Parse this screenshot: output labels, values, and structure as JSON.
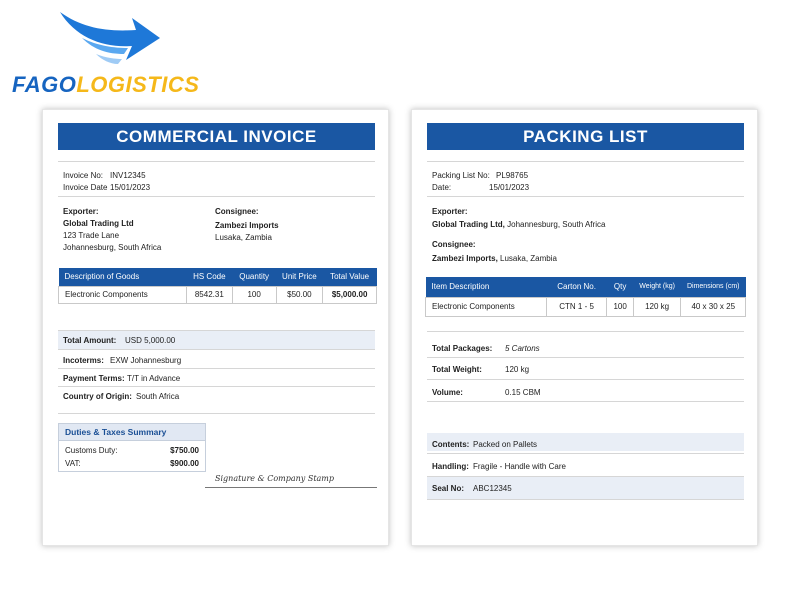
{
  "logo": {
    "part1": "FAGO",
    "part2": "LOGISTICS",
    "primary_color": "#1664c0",
    "accent_color": "#f5b81a"
  },
  "invoice": {
    "title": "COMMERCIAL INVOICE",
    "invoice_no_label": "Invoice No:",
    "invoice_no": "INV12345",
    "invoice_date_label": "Invoice Date",
    "invoice_date": "15/01/2023",
    "exporter_label": "Exporter:",
    "exporter_name": "Global Trading Ltd",
    "exporter_addr1": "123 Trade Lane",
    "exporter_addr2": "Johannesburg, South Africa",
    "consignee_label": "Consignee:",
    "consignee_name": "Zambezi Imports",
    "consignee_addr": "Lusaka, Zambia",
    "table_headers": [
      "Description of Goods",
      "HS Code",
      "Quantity",
      "Unit Price",
      "Total Value"
    ],
    "table_rows": [
      [
        "Electronic Components",
        "8542.31",
        "100",
        "$50.00",
        "$5,000.00"
      ]
    ],
    "total_amount_label": "Total Amount:",
    "total_amount": "USD 5,000.00",
    "incoterms_label": "Incoterms:",
    "incoterms": "EXW Johannesburg",
    "payment_terms_label": "Payment Terms:",
    "payment_terms": "T/T in Advance",
    "origin_label": "Country of Origin:",
    "origin": "South Africa",
    "duties_title": "Duties & Taxes Summary",
    "customs_label": "Customs Duty:",
    "customs_value": "$750.00",
    "vat_label": "VAT:",
    "vat_value": "$900.00",
    "signature": "Signature & Company Stamp"
  },
  "packing": {
    "title": "PACKING LIST",
    "list_no_label": "Packing List No:",
    "list_no": "PL98765",
    "date_label": "Date:",
    "date": "15/01/2023",
    "exporter_label": "Exporter:",
    "exporter_name": "Global Trading Ltd,",
    "exporter_addr": "Johannesburg, South Africa",
    "consignee_label": "Consignee:",
    "consignee_name": "Zambezi Imports,",
    "consignee_addr": "Lusaka, Zambia",
    "table_headers": [
      "Item Description",
      "Carton No.",
      "Qty",
      "Weight (kg)",
      "Dimensions (cm)"
    ],
    "table_rows": [
      [
        "Electronic Components",
        "CTN 1 - 5",
        "100",
        "120 kg",
        "40 x 30 x 25"
      ]
    ],
    "total_packages_label": "Total Packages:",
    "total_packages": "5 Cartons",
    "total_weight_label": "Total Weight:",
    "total_weight": "120 kg",
    "volume_label": "Volume:",
    "volume": "0.15 CBM",
    "contents_label": "Contents:",
    "contents": "Packed on Pallets",
    "handling_label": "Handling:",
    "handling": "Fragile - Handle with Care",
    "seal_label": "Seal No:",
    "seal": "ABC12345"
  }
}
